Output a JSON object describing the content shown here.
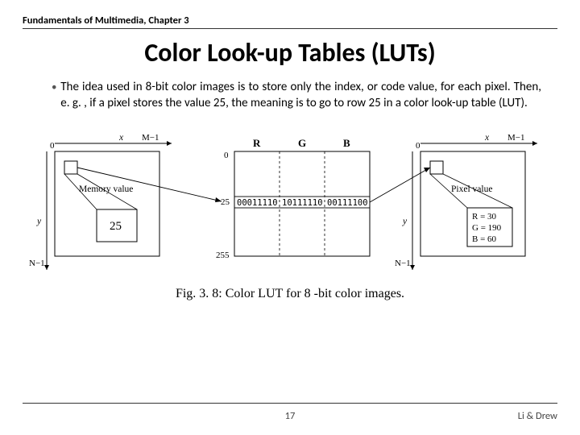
{
  "header": "Fundamentals of Multimedia, Chapter 3",
  "title": "Color Look-up Tables (LUTs)",
  "bullet": "The idea used in 8-bit color images is to store only the index, or code value, for each pixel. Then, e. g. , if a pixel stores the value 25, the meaning is to go to row 25 in a color look-up table (LUT).",
  "figure": {
    "left": {
      "top_left": "0",
      "x_arrow": "x",
      "x_end": "M−1",
      "y_arrow": "y",
      "y_end": "N−1",
      "label": "Memory value",
      "box_value": "25"
    },
    "lut": {
      "cols": [
        "R",
        "G",
        "B"
      ],
      "row0": "0",
      "row_idx": "25",
      "row_end": "255",
      "bits": [
        "00011110",
        "10111110",
        "00111100"
      ]
    },
    "right": {
      "top_left": "0",
      "x_arrow": "x",
      "x_end": "M−1",
      "y_arrow": "y",
      "y_end": "N−1",
      "label": "Pixel value",
      "px_r": "R = 30",
      "px_g": "G = 190",
      "px_b": "B = 60"
    },
    "caption": "Fig. 3. 8: Color LUT for 8 -bit color images."
  },
  "footer": {
    "page": "17",
    "authors": "Li & Drew"
  }
}
